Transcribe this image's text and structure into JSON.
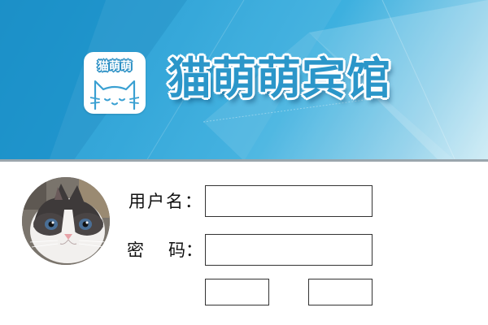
{
  "header": {
    "logo_text": "猫萌萌",
    "title": "猫萌萌宾馆"
  },
  "form": {
    "username_label": "用户名：",
    "password_label_part1": "密",
    "password_label_part2": "码：",
    "username_value": "",
    "password_value": "",
    "button_left_label": "",
    "button_right_label": ""
  },
  "colors": {
    "banner_primary": "#2aa3d8",
    "title_fill": "#2b96c9",
    "border": "#333333"
  },
  "icons": {
    "logo": "cat-face-icon",
    "avatar": "cat-photo-avatar"
  }
}
